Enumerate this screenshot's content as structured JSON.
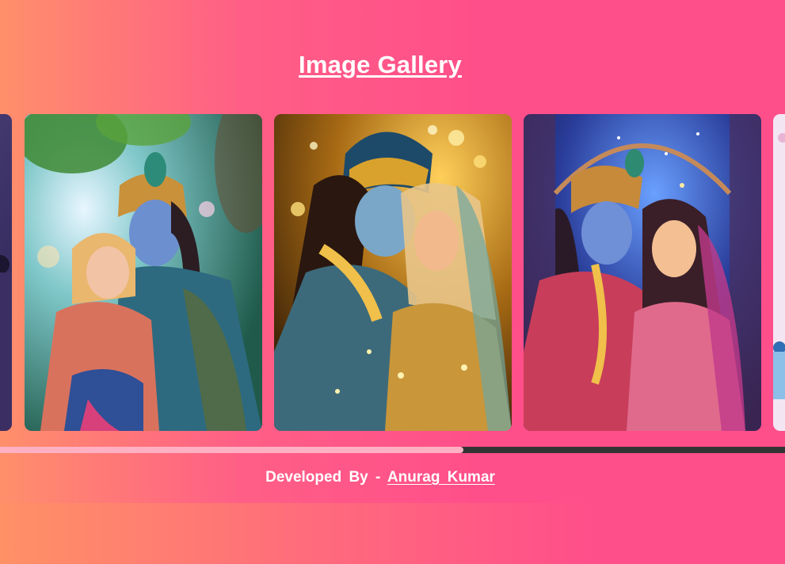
{
  "header": {
    "title": "Image Gallery"
  },
  "gallery": {
    "cards": [
      {
        "name": "gallery-image-previous-partial"
      },
      {
        "name": "gallery-image-krishna-radha-garden"
      },
      {
        "name": "gallery-image-krishna-radha-golden-lights"
      },
      {
        "name": "gallery-image-krishna-radha-starry-palace"
      },
      {
        "name": "gallery-image-next-partial"
      }
    ],
    "scroll_position": 0.59
  },
  "footer": {
    "prefix": "Developed By -",
    "author_link": "Anurag Kumar"
  },
  "colors": {
    "background": "#ff4f8a",
    "scroll_thumb": "#ffb0c2",
    "scroll_track": "#333333",
    "text": "#ffffff"
  }
}
